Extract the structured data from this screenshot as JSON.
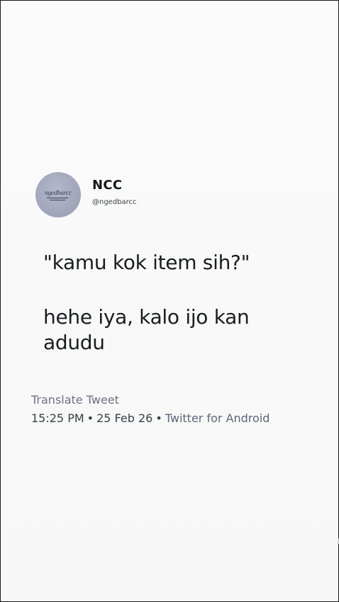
{
  "tweet": {
    "display_name": "NCC",
    "handle": "@ngedbarcc",
    "avatar_text": "ngedbarcc",
    "text_line1": "\"kamu kok item sih?\"",
    "text_line2": "hehe iya, kalo ijo kan adudu",
    "translate_label": "Translate Tweet",
    "time": "15:25 PM",
    "date": "25 Feb 26",
    "separator": "•",
    "client": "Twitter for Android"
  },
  "colors": {
    "background": "#f9f9f9",
    "avatar": "#a3a7bc",
    "text": "#1b1c1e",
    "muted": "#6b7184"
  }
}
